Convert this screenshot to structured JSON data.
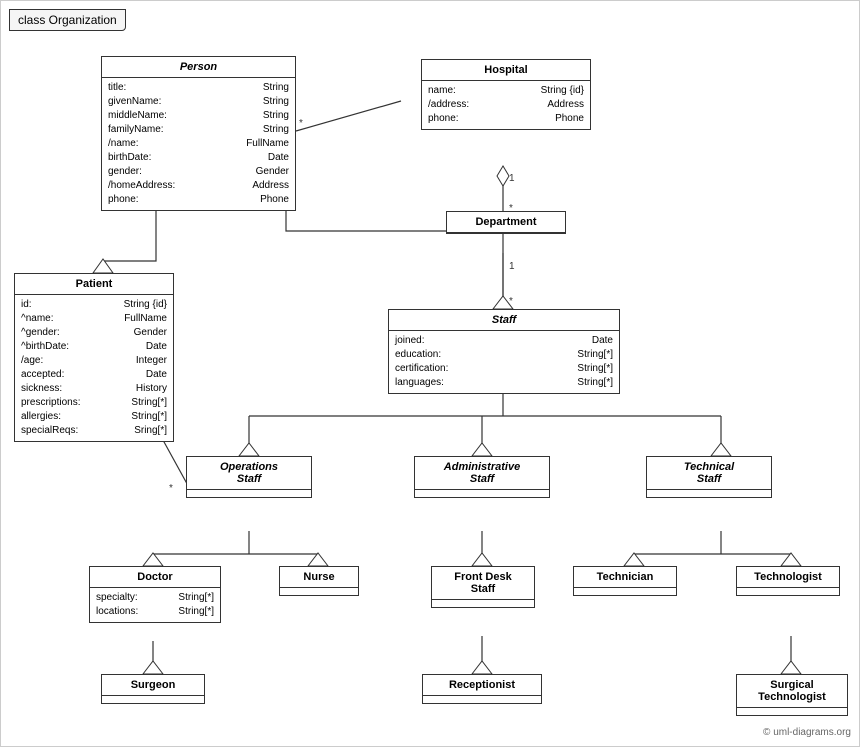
{
  "diagram": {
    "title": "class Organization",
    "classes": {
      "person": {
        "name": "Person",
        "italic": true,
        "attrs": [
          {
            "name": "title:",
            "type": "String"
          },
          {
            "name": "givenName:",
            "type": "String"
          },
          {
            "name": "middleName:",
            "type": "String"
          },
          {
            "name": "familyName:",
            "type": "String"
          },
          {
            "name": "/name:",
            "type": "FullName"
          },
          {
            "name": "birthDate:",
            "type": "Date"
          },
          {
            "name": "gender:",
            "type": "Gender"
          },
          {
            "name": "/homeAddress:",
            "type": "Address"
          },
          {
            "name": "phone:",
            "type": "Phone"
          }
        ]
      },
      "hospital": {
        "name": "Hospital",
        "italic": false,
        "attrs": [
          {
            "name": "name:",
            "type": "String {id}"
          },
          {
            "name": "/address:",
            "type": "Address"
          },
          {
            "name": "phone:",
            "type": "Phone"
          }
        ]
      },
      "department": {
        "name": "Department",
        "italic": false,
        "attrs": []
      },
      "staff": {
        "name": "Staff",
        "italic": true,
        "attrs": [
          {
            "name": "joined:",
            "type": "Date"
          },
          {
            "name": "education:",
            "type": "String[*]"
          },
          {
            "name": "certification:",
            "type": "String[*]"
          },
          {
            "name": "languages:",
            "type": "String[*]"
          }
        ]
      },
      "patient": {
        "name": "Patient",
        "italic": false,
        "attrs": [
          {
            "name": "id:",
            "type": "String {id}"
          },
          {
            "name": "^name:",
            "type": "FullName"
          },
          {
            "name": "^gender:",
            "type": "Gender"
          },
          {
            "name": "^birthDate:",
            "type": "Date"
          },
          {
            "name": "/age:",
            "type": "Integer"
          },
          {
            "name": "accepted:",
            "type": "Date"
          },
          {
            "name": "sickness:",
            "type": "History"
          },
          {
            "name": "prescriptions:",
            "type": "String[*]"
          },
          {
            "name": "allergies:",
            "type": "String[*]"
          },
          {
            "name": "specialReqs:",
            "type": "Sring[*]"
          }
        ]
      },
      "ops_staff": {
        "name": "Operations\nStaff",
        "italic": true,
        "attrs": []
      },
      "admin_staff": {
        "name": "Administrative\nStaff",
        "italic": true,
        "attrs": []
      },
      "tech_staff": {
        "name": "Technical\nStaff",
        "italic": true,
        "attrs": []
      },
      "doctor": {
        "name": "Doctor",
        "italic": false,
        "attrs": [
          {
            "name": "specialty:",
            "type": "String[*]"
          },
          {
            "name": "locations:",
            "type": "String[*]"
          }
        ]
      },
      "nurse": {
        "name": "Nurse",
        "italic": false,
        "attrs": []
      },
      "front_desk": {
        "name": "Front Desk\nStaff",
        "italic": false,
        "attrs": []
      },
      "technician": {
        "name": "Technician",
        "italic": false,
        "attrs": []
      },
      "technologist": {
        "name": "Technologist",
        "italic": false,
        "attrs": []
      },
      "surgeon": {
        "name": "Surgeon",
        "italic": false,
        "attrs": []
      },
      "receptionist": {
        "name": "Receptionist",
        "italic": false,
        "attrs": []
      },
      "surgical_tech": {
        "name": "Surgical\nTechnologist",
        "italic": false,
        "attrs": []
      }
    },
    "watermark": "© uml-diagrams.org"
  }
}
